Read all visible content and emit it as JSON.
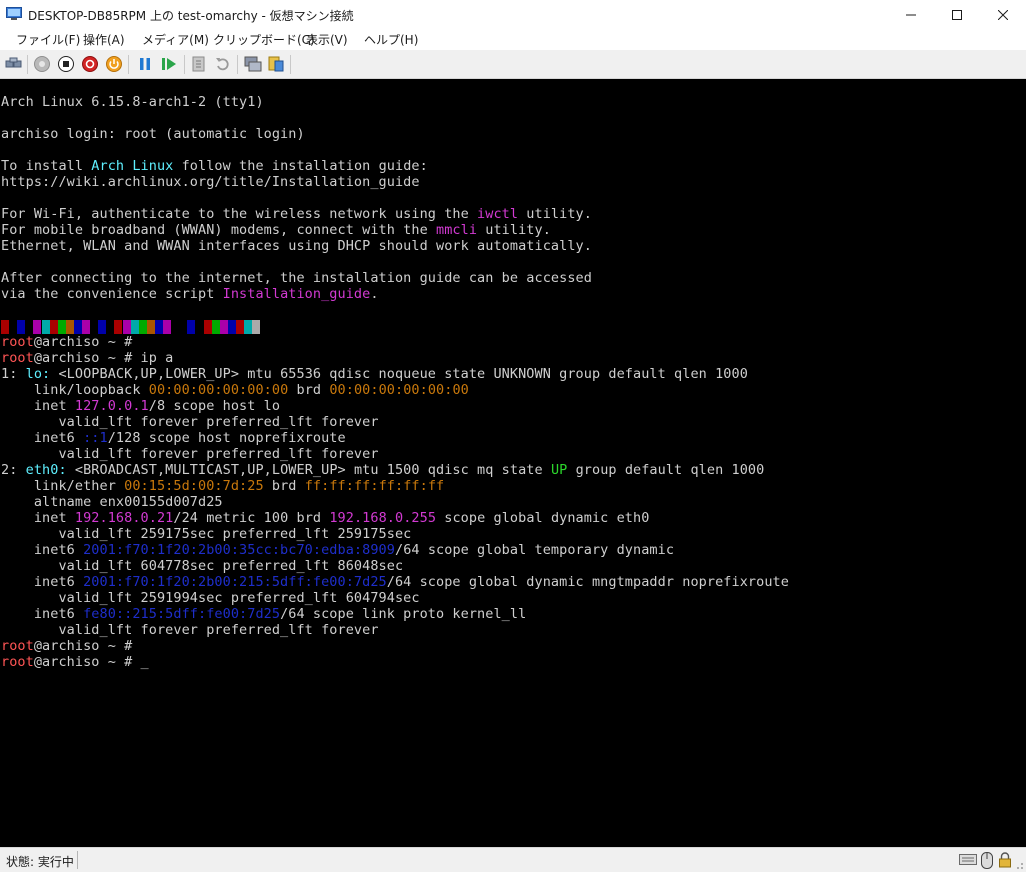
{
  "window": {
    "title": "DESKTOP-DB85RPM 上の test-omarchy - 仮想マシン接続"
  },
  "menu": [
    "ファイル(F)",
    "操作(A)",
    "メディア(M)",
    "クリップボード(C)",
    "表示(V)",
    "ヘルプ(H)"
  ],
  "toolbar": {
    "icons": [
      "ctrl-alt-del-icon",
      "start-icon",
      "turn-off-icon",
      "shutdown-icon",
      "save-icon",
      "pause-icon",
      "reset-icon",
      "checkpoint-icon",
      "revert-icon",
      "enhanced-session-icon",
      "share-icon"
    ]
  },
  "colors": {
    "cyan": "#5ff0ff",
    "blue": "#2f72ff",
    "magenta": "#d23ad2",
    "green": "#2bd62b",
    "orange": "#c8780c",
    "red": "#ff5555",
    "navy": "#1e2ecb"
  },
  "palette_blocks": [
    "#aa0000",
    "#000000",
    "#0000aa",
    "#000000",
    "#aa00aa",
    "#00aaaa",
    "#aa0000",
    "#00aa00",
    "#aa5500",
    "#0000aa",
    "#aa00aa",
    "#000000",
    "#0000aa",
    "#000000",
    "#aa0000",
    "#aa00aa",
    "#00aaaa",
    "#00aa00",
    "#aa5500",
    "#0000aa",
    "#aa00aa",
    "#000000",
    "#000000",
    "#0000aa",
    "#000000",
    "#aa0000",
    "#00aa00",
    "#aa00aa",
    "#0000aa",
    "#aa0000",
    "#00aaaa",
    "#aaaaaa"
  ],
  "terminal": {
    "l1": "Arch Linux 6.15.8-arch1-2 (tty1)",
    "l2": "archiso login: root (automatic login)",
    "l3a": "To install ",
    "l3b": "Arch Linux",
    "l3c": " follow the installation guide:",
    "l4": "https://wiki.archlinux.org/title/Installation_guide",
    "l5a": "For Wi-Fi, authenticate to the wireless network using the ",
    "l5b": "iwctl",
    "l5c": " utility.",
    "l6a": "For mobile broadband (WWAN) modems, connect with the ",
    "l6b": "mmcli",
    "l6c": " utility.",
    "l7": "Ethernet, WLAN and WWAN interfaces using DHCP should work automatically.",
    "l8": "After connecting to the internet, the installation guide can be accessed",
    "l9a": "via the convenience script ",
    "l9b": "Installation_guide",
    "l9c": ".",
    "prompt_user": "root",
    "prompt_rest": "@archiso ~ # ",
    "cmd": "ip a",
    "lo1a": "1: ",
    "lo1b": "lo:",
    "lo1c": " <LOOPBACK,UP,LOWER_UP> mtu 65536 qdisc noqueue state UNKNOWN group default qlen 1000",
    "lo2a": "    link/loopback ",
    "lo2b": "00:00:00:00:00:00",
    "lo2c": " brd ",
    "lo2d": "00:00:00:00:00:00",
    "lo3a": "    inet ",
    "lo3b": "127.0.0.1",
    "lo3c": "/8 scope host lo",
    "lo4": "       valid_lft forever preferred_lft forever",
    "lo5a": "    inet6 ",
    "lo5b": "::1",
    "lo5c": "/128 scope host noprefixroute",
    "lo6": "       valid_lft forever preferred_lft forever",
    "e1a": "2: ",
    "e1b": "eth0:",
    "e1c": " <BROADCAST,MULTICAST,UP,LOWER_UP> mtu 1500 qdisc mq state ",
    "e1d": "UP",
    "e1e": " group default qlen 1000",
    "e2a": "    link/ether ",
    "e2b": "00:15:5d:00:7d:25",
    "e2c": " brd ",
    "e2d": "ff:ff:ff:ff:ff:ff",
    "e3": "    altname enx00155d007d25",
    "e4a": "    inet ",
    "e4b": "192.168.0.21",
    "e4c": "/24 metric 100 brd ",
    "e4d": "192.168.0.255",
    "e4e": " scope global dynamic eth0",
    "e5": "       valid_lft 259175sec preferred_lft 259175sec",
    "e6a": "    inet6 ",
    "e6b": "2001:f70:1f20:2b00:35cc:bc70:edba:8909",
    "e6c": "/64 scope global temporary dynamic",
    "e7": "       valid_lft 604778sec preferred_lft 86048sec",
    "e8a": "    inet6 ",
    "e8b": "2001:f70:1f20:2b00:215:5dff:fe00:7d25",
    "e8c": "/64 scope global dynamic mngtmpaddr noprefixroute",
    "e9": "       valid_lft 2591994sec preferred_lft 604794sec",
    "e10a": "    inet6 ",
    "e10b": "fe80::215:5dff:fe00:7d25",
    "e10c": "/64 scope link proto kernel_ll",
    "e11": "       valid_lft forever preferred_lft forever",
    "cursor": "_"
  },
  "status": {
    "text": "状態: 実行中"
  }
}
